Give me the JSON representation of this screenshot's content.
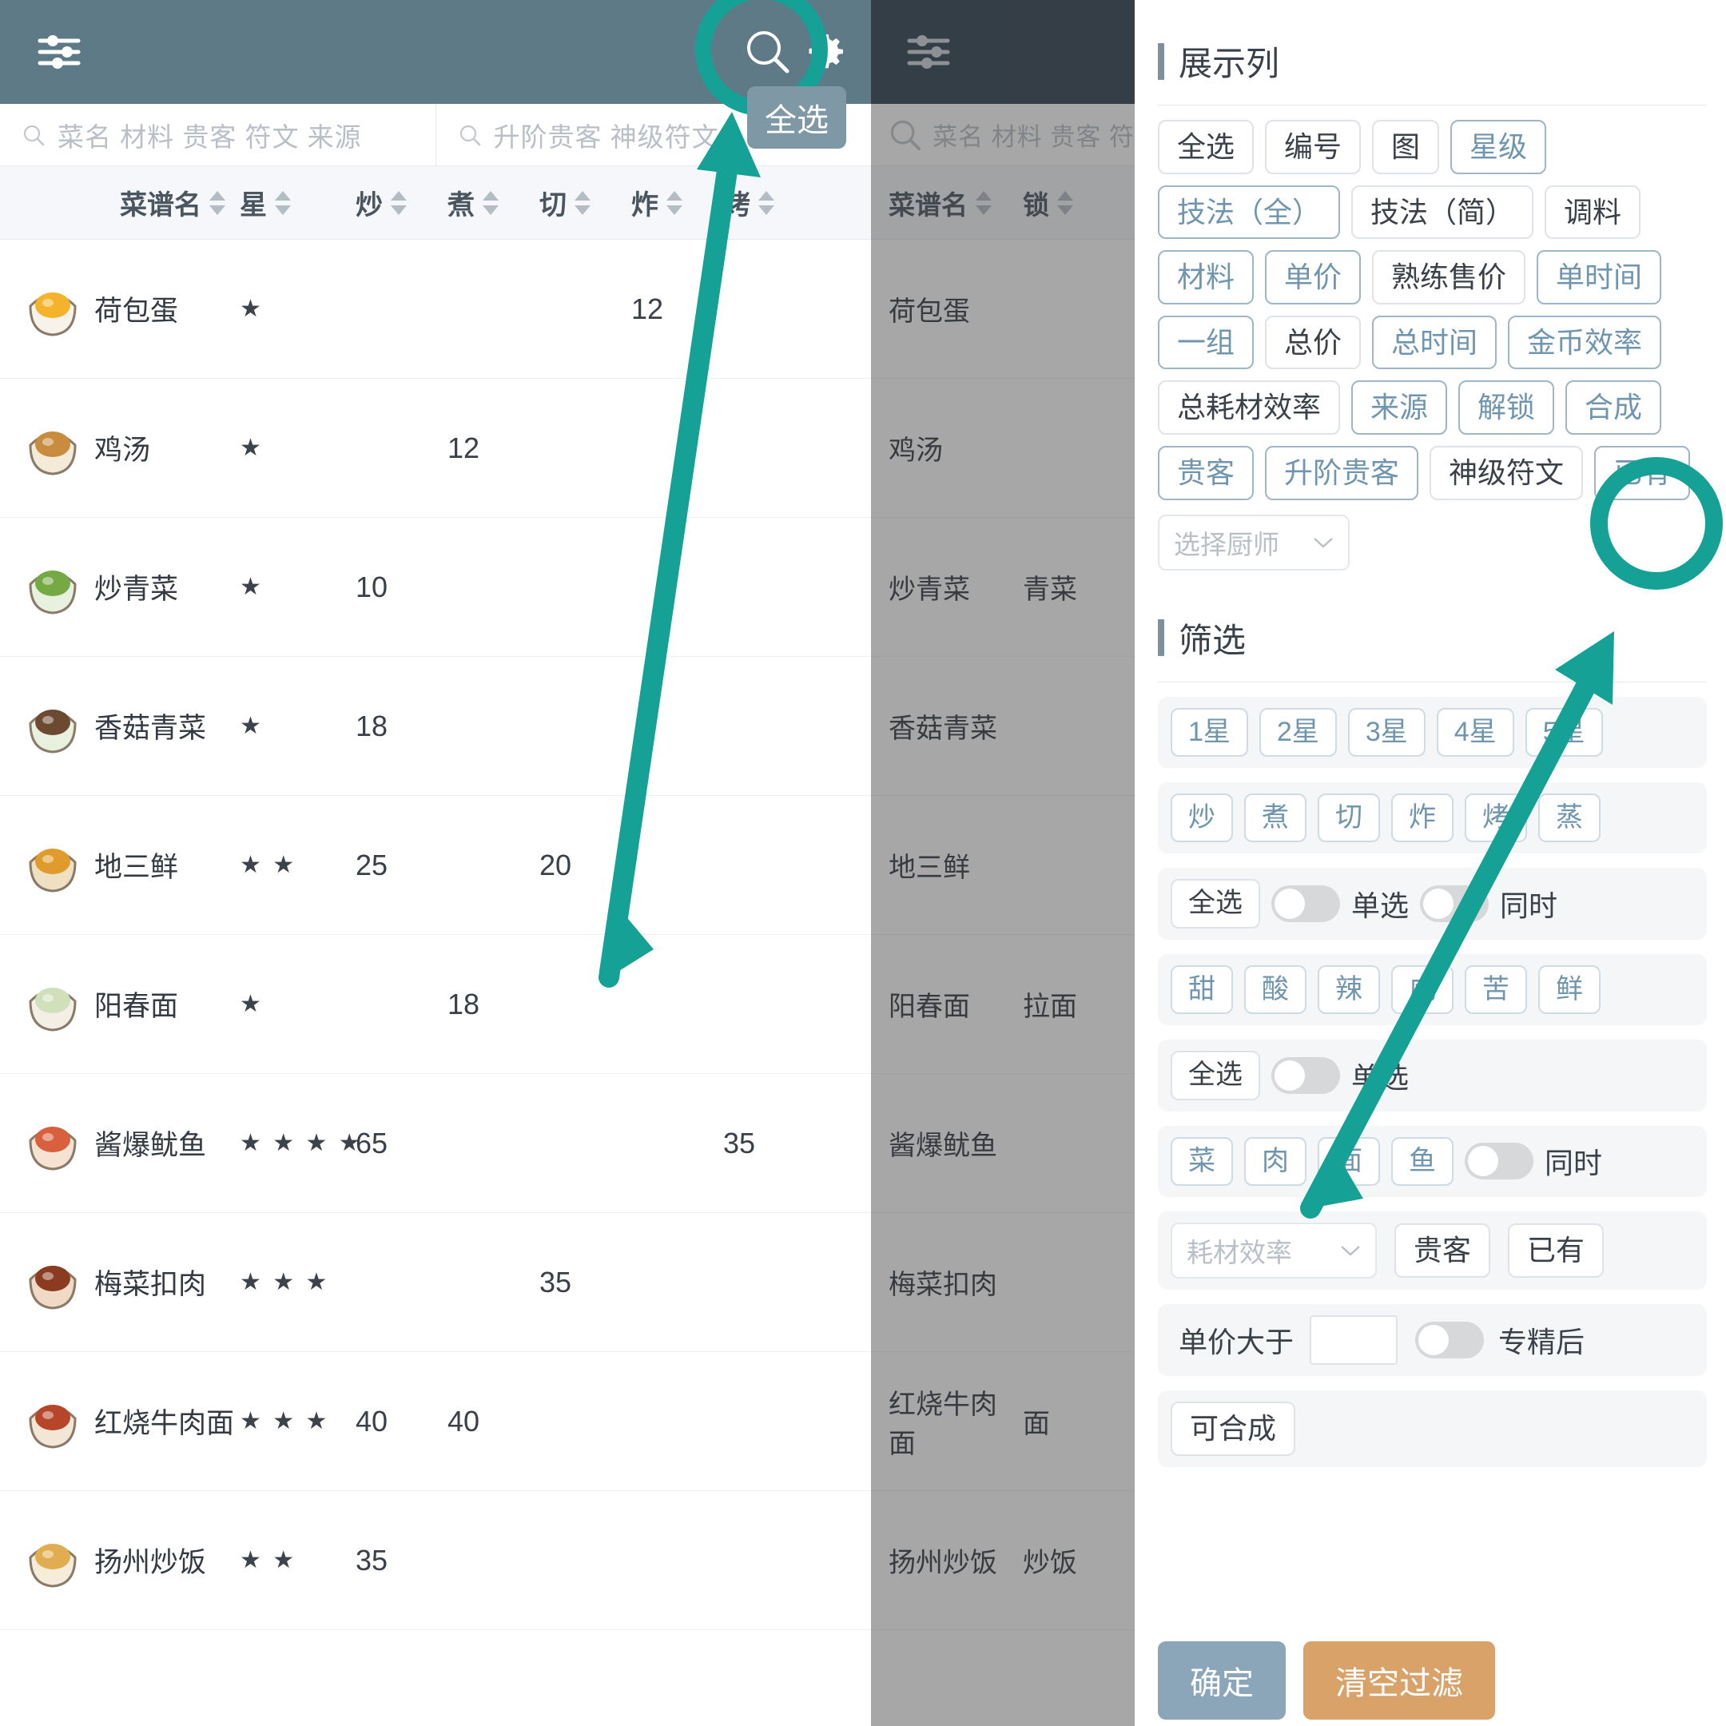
{
  "colors": {
    "accent_teal": "#15a195",
    "panel1_topbar": "#5e7a86",
    "panel2_topbar": "#2f4050",
    "chip_active_text": "#6f96ae",
    "confirm_button": "#8aa6b8",
    "clear_button": "#d9a268"
  },
  "panel1": {
    "topbar": {
      "filter_icon": "sliders-icon",
      "search_icon": "search-icon",
      "gear_icon": "gear-icon"
    },
    "tooltip": "全选",
    "search_inputs": [
      {
        "placeholder": "菜名 材料 贵客 符文 来源",
        "value": ""
      },
      {
        "placeholder": "升阶贵客 神级符文",
        "value": ""
      }
    ],
    "columns": [
      "菜谱名",
      "星",
      "炒",
      "煮",
      "切",
      "炸",
      "烤"
    ],
    "rows": [
      {
        "icon": "fried-egg",
        "name": "荷包蛋",
        "stars": "★",
        "chao": "",
        "zhu": "",
        "qie": "",
        "zha": "12",
        "kao": ""
      },
      {
        "icon": "chicken-soup",
        "name": "鸡汤",
        "stars": "★",
        "chao": "",
        "zhu": "12",
        "qie": "",
        "zha": "",
        "kao": ""
      },
      {
        "icon": "greens",
        "name": "炒青菜",
        "stars": "★",
        "chao": "10",
        "zhu": "",
        "qie": "",
        "zha": "",
        "kao": ""
      },
      {
        "icon": "mushroom-greens",
        "name": "香菇青菜",
        "stars": "★",
        "chao": "18",
        "zhu": "",
        "qie": "",
        "zha": "",
        "kao": ""
      },
      {
        "icon": "di-san-xian",
        "name": "地三鲜",
        "stars": "★ ★",
        "chao": "25",
        "zhu": "",
        "qie": "20",
        "zha": "",
        "kao": ""
      },
      {
        "icon": "noodles",
        "name": "阳春面",
        "stars": "★",
        "chao": "",
        "zhu": "18",
        "qie": "",
        "zha": "",
        "kao": ""
      },
      {
        "icon": "squid",
        "name": "酱爆鱿鱼",
        "stars": "★ ★ ★ ★",
        "chao": "65",
        "zhu": "",
        "qie": "",
        "zha": "",
        "kao": "35"
      },
      {
        "icon": "braised-pork",
        "name": "梅菜扣肉",
        "stars": "★ ★ ★",
        "chao": "",
        "zhu": "",
        "qie": "35",
        "zha": "",
        "kao": ""
      },
      {
        "icon": "beef-noodle",
        "name": "红烧牛肉面",
        "stars": "★ ★ ★",
        "chao": "40",
        "zhu": "40",
        "qie": "",
        "zha": "",
        "kao": ""
      },
      {
        "icon": "fried-rice",
        "name": "扬州炒饭",
        "stars": "★ ★",
        "chao": "35",
        "zhu": "",
        "qie": "",
        "zha": "",
        "kao": ""
      }
    ]
  },
  "panel2": {
    "topbar": {
      "filter_icon": "sliders-icon"
    },
    "search_input": {
      "placeholder": "菜名 材料 贵客 符",
      "value": ""
    },
    "columns": [
      "菜谱名",
      "锁"
    ],
    "rows": [
      {
        "name": "荷包蛋",
        "lock": ""
      },
      {
        "name": "鸡汤",
        "lock": ""
      },
      {
        "name": "炒青菜",
        "lock": "青菜"
      },
      {
        "name": "香菇青菜",
        "lock": ""
      },
      {
        "name": "地三鲜",
        "lock": ""
      },
      {
        "name": "阳春面",
        "lock": "拉面"
      },
      {
        "name": "酱爆鱿鱼",
        "lock": ""
      },
      {
        "name": "梅菜扣肉",
        "lock": ""
      },
      {
        "name": "红烧牛肉面",
        "lock": "面"
      },
      {
        "name": "扬州炒饭",
        "lock": "炒饭"
      }
    ]
  },
  "panel3": {
    "display_columns": {
      "title": "展示列",
      "chips": [
        {
          "label": "全选",
          "active": false
        },
        {
          "label": "编号",
          "active": false
        },
        {
          "label": "图",
          "active": false
        },
        {
          "label": "星级",
          "active": true
        },
        {
          "label": "技法（全）",
          "active": true
        },
        {
          "label": "技法（简）",
          "active": false
        },
        {
          "label": "调料",
          "active": false
        },
        {
          "label": "材料",
          "active": true
        },
        {
          "label": "单价",
          "active": true
        },
        {
          "label": "熟练售价",
          "active": false
        },
        {
          "label": "单时间",
          "active": true
        },
        {
          "label": "一组",
          "active": true
        },
        {
          "label": "总价",
          "active": false
        },
        {
          "label": "总时间",
          "active": true
        },
        {
          "label": "金币效率",
          "active": true
        },
        {
          "label": "总耗材效率",
          "active": false
        },
        {
          "label": "来源",
          "active": true
        },
        {
          "label": "解锁",
          "active": true
        },
        {
          "label": "合成",
          "active": true
        },
        {
          "label": "贵客",
          "active": true
        },
        {
          "label": "升阶贵客",
          "active": true
        },
        {
          "label": "神级符文",
          "active": false
        },
        {
          "label": "已有",
          "active": true
        }
      ],
      "chef_select": {
        "placeholder": "选择厨师",
        "value": ""
      }
    },
    "filter": {
      "title": "筛选",
      "star_chips": [
        "1星",
        "2星",
        "3星",
        "4星",
        "5星"
      ],
      "star_toggles": [
        {
          "label": "全选",
          "type": "chip"
        },
        {
          "label": "单选",
          "type": "toggle",
          "on": false
        },
        {
          "label": "同时",
          "type": "toggle",
          "on": false
        }
      ],
      "method_chips": [
        "炒",
        "煮",
        "切",
        "炸",
        "烤",
        "蒸"
      ],
      "taste_chips": [
        "甜",
        "酸",
        "辣",
        "咸",
        "苦",
        "鲜"
      ],
      "taste_toggles": [
        {
          "label": "全选",
          "type": "chip"
        },
        {
          "label": "单选",
          "type": "toggle",
          "on": false
        }
      ],
      "category_chips": [
        "菜",
        "肉",
        "面",
        "鱼"
      ],
      "category_toggle": {
        "label": "同时",
        "on": false
      },
      "efficiency_select": {
        "placeholder": "耗材效率",
        "value": ""
      },
      "guest_chip": "贵客",
      "owned_chip": "已有",
      "price_filter": {
        "label": "单价大于",
        "value": "",
        "toggle_label": "专精后",
        "toggle_on": false
      },
      "composable_chip": "可合成"
    },
    "footer": {
      "confirm": "确定",
      "clear": "清空过滤"
    }
  },
  "annotations": {
    "circle_search": {
      "target": "search-icon"
    },
    "circle_owned": {
      "target": "已有"
    },
    "arrow_to_search_label": "全选"
  }
}
